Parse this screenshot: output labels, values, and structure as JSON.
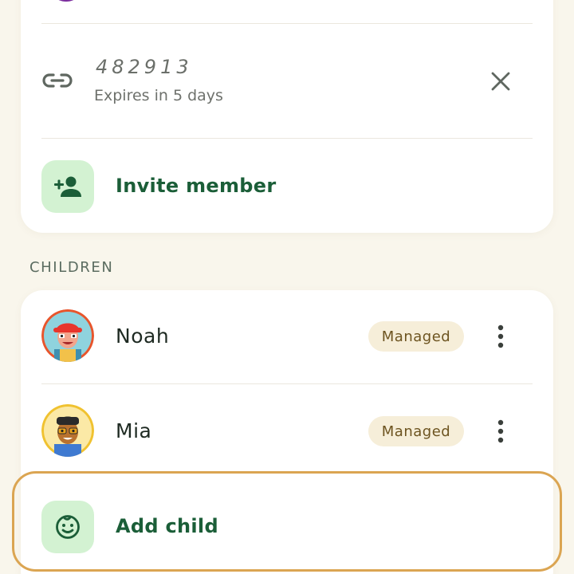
{
  "invite_code": {
    "code": "482913",
    "expires": "Expires in 5 days",
    "icon": "link-icon",
    "close_icon": "close-icon"
  },
  "invite_member": {
    "label": "Invite member",
    "icon": "person-add-icon"
  },
  "children_section": {
    "header": "CHILDREN",
    "children": [
      {
        "name": "Noah",
        "badge": "Managed",
        "avatar": "avatar-noah"
      },
      {
        "name": "Mia",
        "badge": "Managed",
        "avatar": "avatar-mia"
      }
    ],
    "more_icon": "more-vert-icon"
  },
  "add_child": {
    "label": "Add child",
    "icon": "child-face-icon"
  },
  "colors": {
    "background": "#f9f6ec",
    "card": "#ffffff",
    "accent_green": "#1b5e38",
    "tile_green": "#d3f2d2",
    "badge_bg": "#f6eed9",
    "focus_ring": "#dba552"
  }
}
